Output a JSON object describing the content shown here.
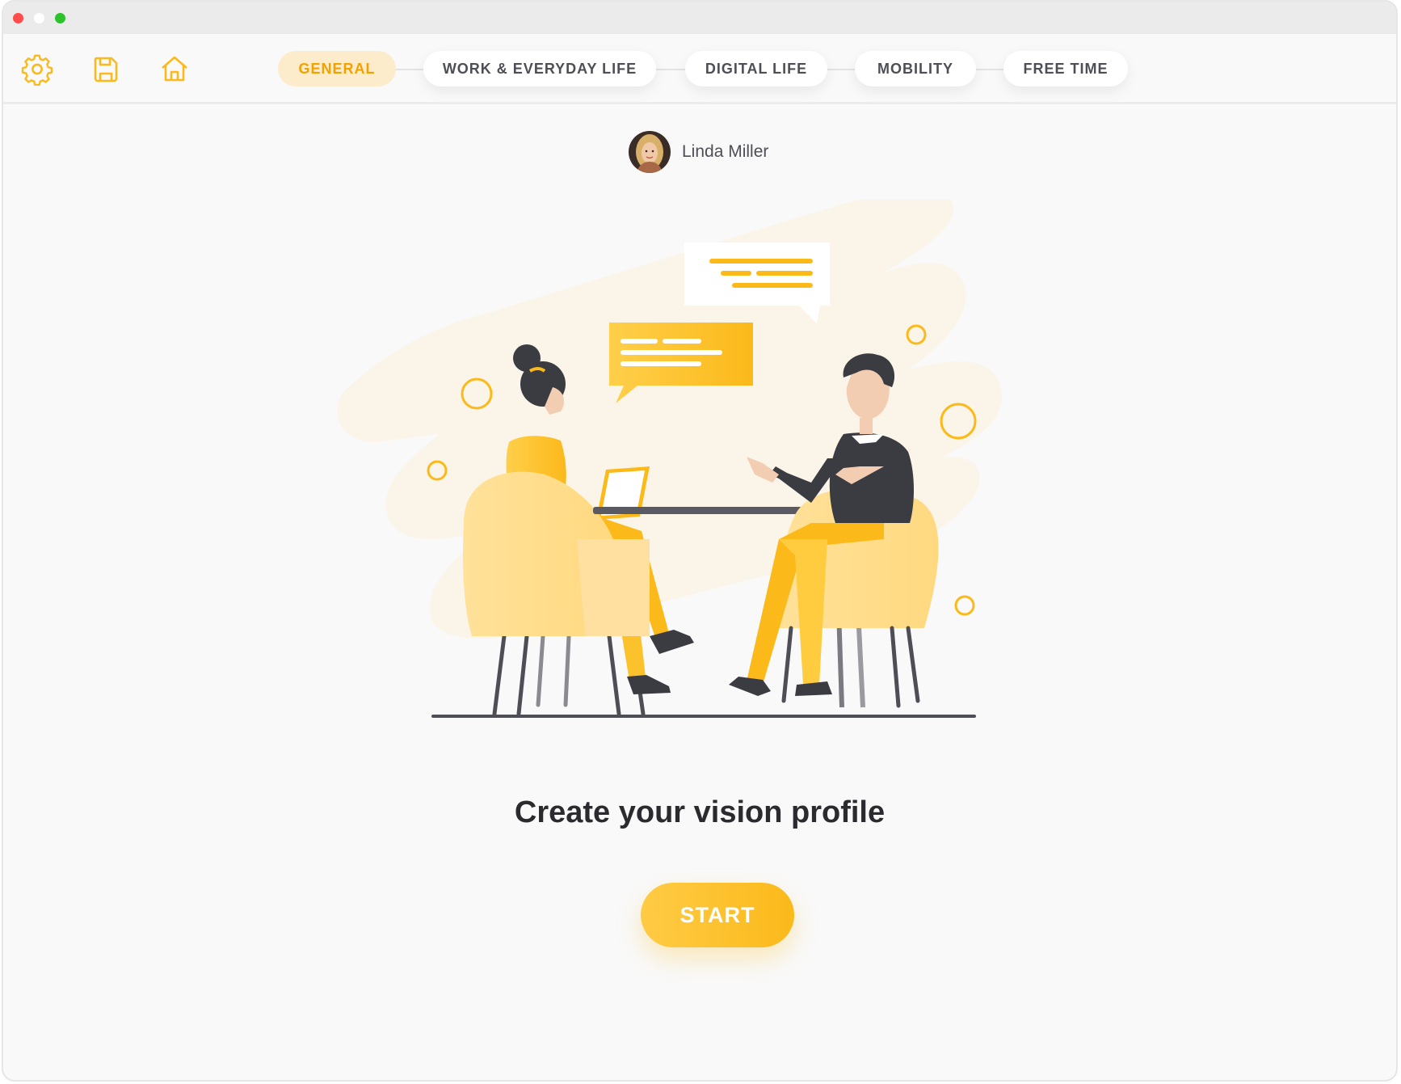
{
  "window_controls": [
    "close",
    "minimize",
    "maximize"
  ],
  "toolbar": {
    "icons": [
      "gear-icon",
      "save-icon",
      "home-icon"
    ],
    "accent_color": "#fbb91a"
  },
  "steps": [
    {
      "label": "GENERAL",
      "active": true
    },
    {
      "label": "WORK & EVERYDAY LIFE",
      "active": false
    },
    {
      "label": "DIGITAL LIFE",
      "active": false
    },
    {
      "label": "MOBILITY",
      "active": false
    },
    {
      "label": "FREE TIME",
      "active": false
    }
  ],
  "user": {
    "name": "Linda Miller"
  },
  "main": {
    "headline": "Create your vision profile",
    "start_label": "START"
  }
}
